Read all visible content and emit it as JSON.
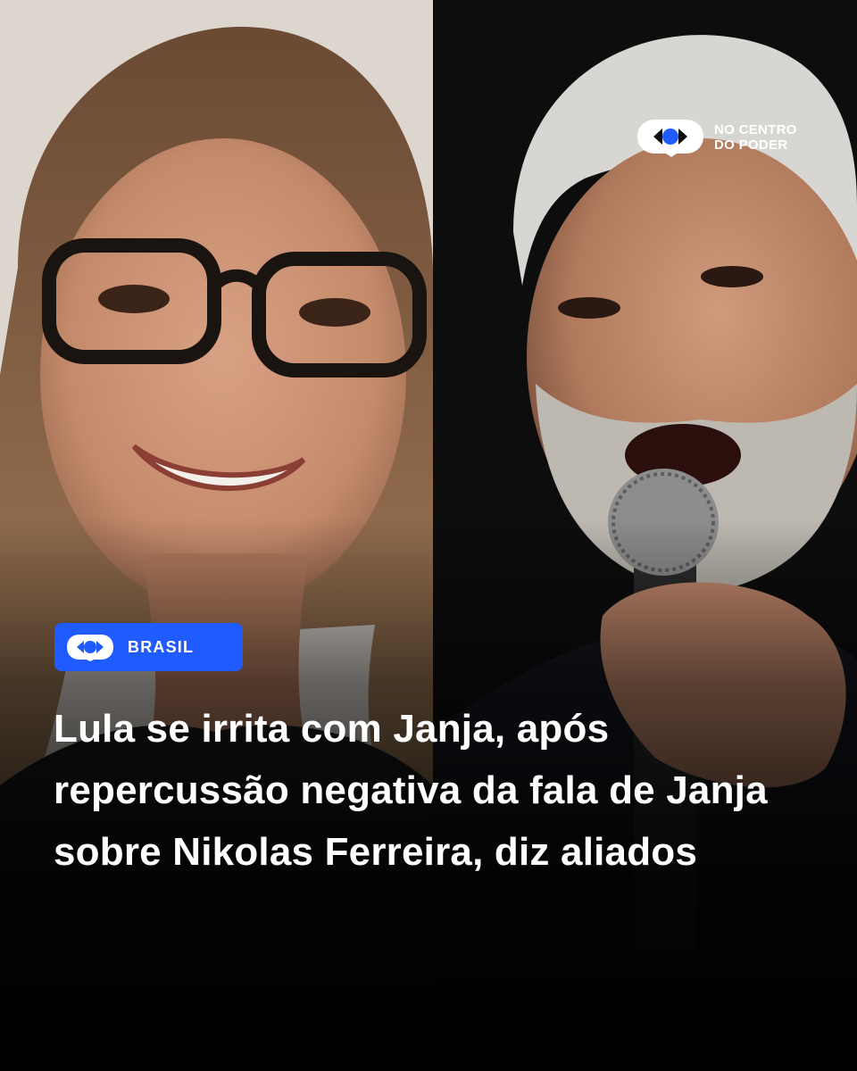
{
  "brand": {
    "name": "NO CENTRO\nDO PODER",
    "color": "#ffffff"
  },
  "badge": {
    "label": "BRASIL",
    "color": "#1f5bff"
  },
  "headline": {
    "text": "Lula se irrita com Janja, após repercussão negativa da fala de Janja sobre Nikolas Ferreira, diz aliados"
  },
  "images": {
    "left": "portrait-woman-glasses",
    "right": "portrait-man-microphone"
  }
}
